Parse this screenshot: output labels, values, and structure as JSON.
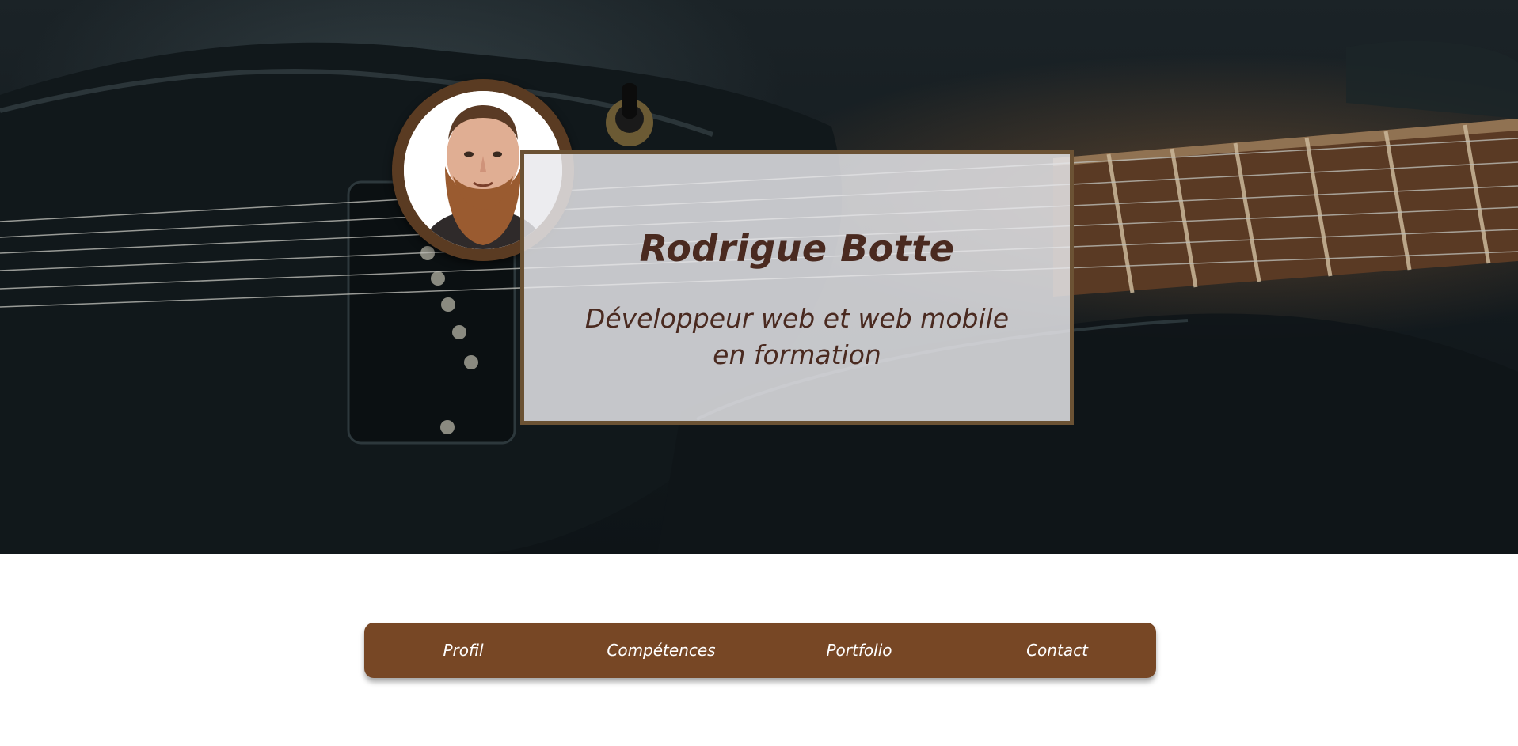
{
  "hero": {
    "background_image": "electric-guitar-photo",
    "profile_photo": "portrait-photo-bearded-man"
  },
  "card": {
    "name": "Rodrigue Botte",
    "subtitle_line1": "Développeur web et web mobile",
    "subtitle_line2": "en formation"
  },
  "nav": {
    "items": [
      {
        "label": "Profil"
      },
      {
        "label": "Compétences"
      },
      {
        "label": "Portfolio"
      },
      {
        "label": "Contact"
      }
    ]
  },
  "colors": {
    "nav_bg": "#774725",
    "title_text": "#4a2a20",
    "card_border": "#6b5234",
    "avatar_ring": "#5a3b22"
  }
}
